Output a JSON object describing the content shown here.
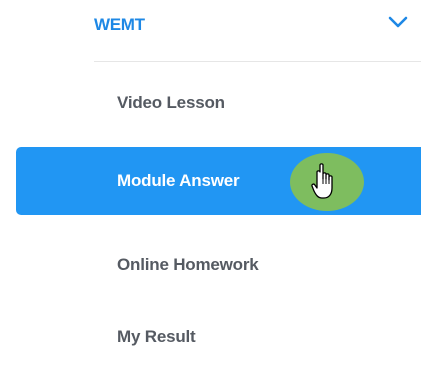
{
  "colors": {
    "accent": "#2196f3",
    "group_title": "#1e88e5",
    "chevron": "#1e88e5",
    "item_text": "#555a62",
    "cursor_halo": "#8bc34a"
  },
  "menu": {
    "group": {
      "title": "WEMT",
      "expand_icon": "chevron-down-icon"
    },
    "items": [
      {
        "label": "Video Lesson",
        "active": false
      },
      {
        "label": "Module Answer",
        "active": true
      },
      {
        "label": "Online Homework",
        "active": false
      },
      {
        "label": "My Result",
        "active": false
      }
    ]
  },
  "cursor": {
    "icon": "hand-pointer-icon"
  }
}
